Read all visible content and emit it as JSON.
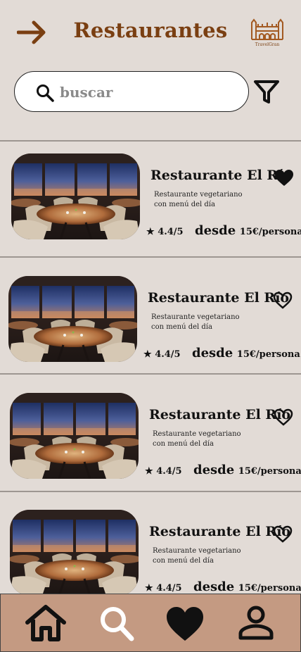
{
  "header": {
    "title": "Restaurantes",
    "logo_text": "TravelGran",
    "back_icon": "arrow-right-icon"
  },
  "search": {
    "placeholder": "buscar",
    "icon": "search-icon",
    "filter_icon": "filter-icon"
  },
  "restaurants": [
    {
      "name": "Restaurante El Río",
      "description": "Restaurante vegetariano con menú del día",
      "rating": "4.4/5",
      "price_prefix": "desde",
      "price": "15€/persona",
      "favorite": true
    },
    {
      "name": "Restaurante El Río",
      "description": "Restaurante vegetariano con menú del día",
      "rating": "4.4/5",
      "price_prefix": "desde",
      "price": "15€/persona",
      "favorite": false
    },
    {
      "name": "Restaurante El Río",
      "description": "Restaurante vegetariano con menú del día",
      "rating": "4.4/5",
      "price_prefix": "desde",
      "price": "15€/persona",
      "favorite": false
    },
    {
      "name": "Restaurante El Río",
      "description": "Restaurante vegetariano con menú del día",
      "rating": "4.4/5",
      "price_prefix": "desde",
      "price": "15€/persona",
      "favorite": false
    }
  ],
  "bottom_nav": [
    {
      "icon": "home-icon"
    },
    {
      "icon": "search-icon"
    },
    {
      "icon": "heart-icon"
    },
    {
      "icon": "user-icon"
    }
  ],
  "colors": {
    "background": "#e2dbd6",
    "accent": "#7a3f12",
    "nav_bar": "#c49a82"
  }
}
